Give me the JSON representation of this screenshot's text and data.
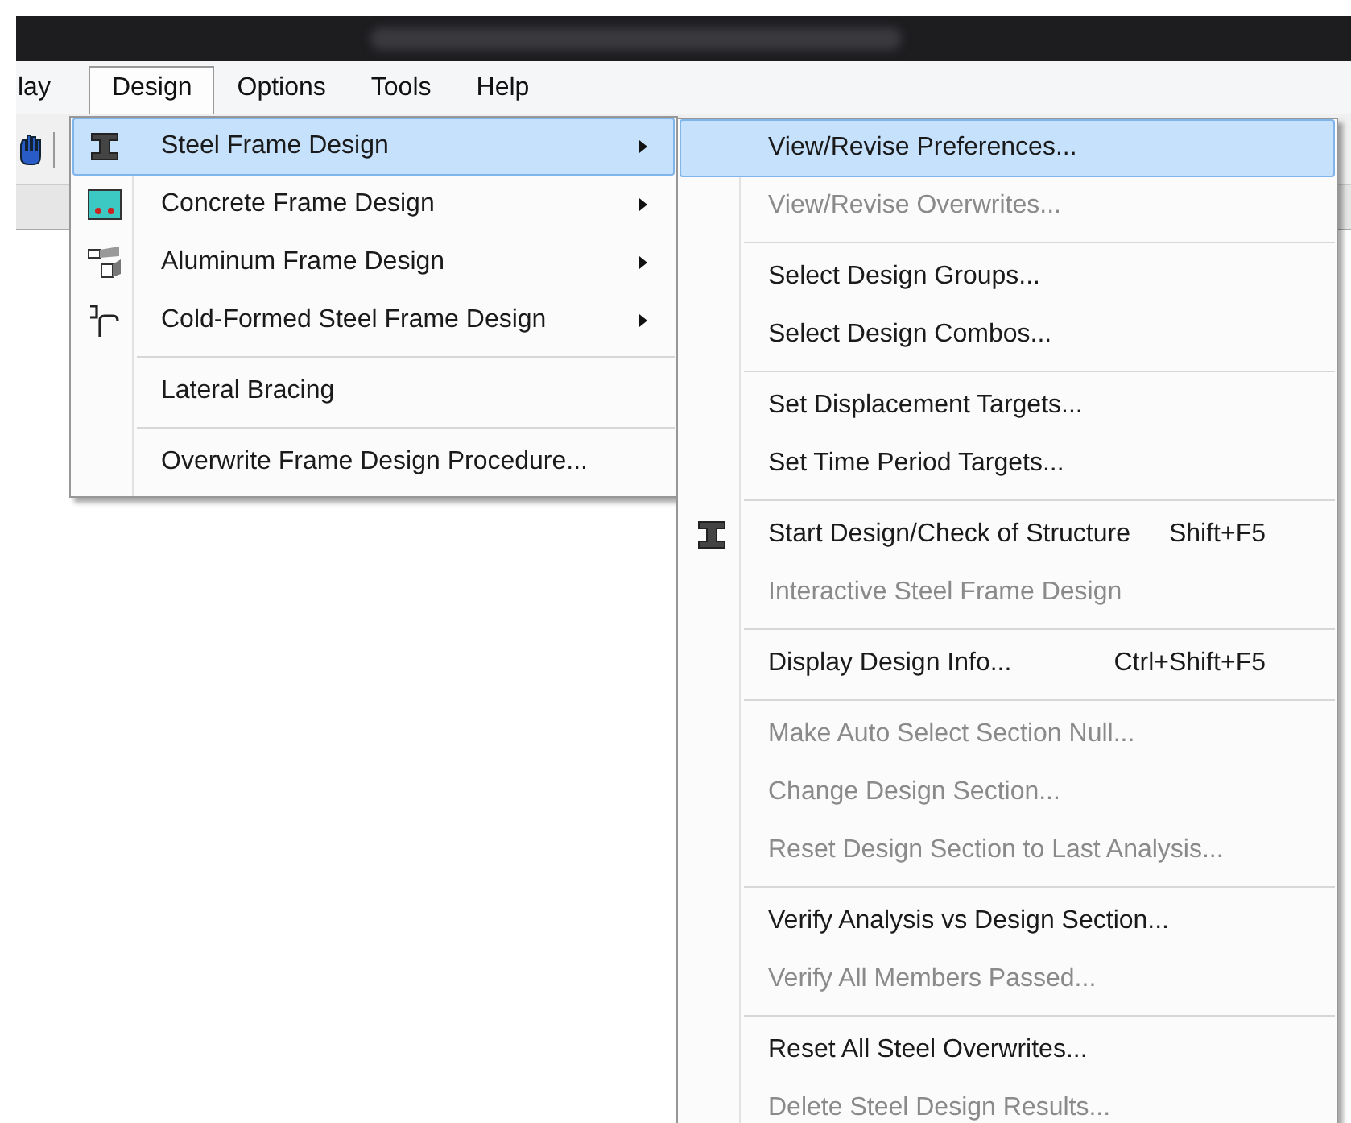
{
  "menubar": {
    "items": [
      {
        "label": "lay",
        "selected": false
      },
      {
        "label": "Design",
        "selected": true
      },
      {
        "label": "Options",
        "selected": false
      },
      {
        "label": "Tools",
        "selected": false
      },
      {
        "label": "Help",
        "selected": false
      }
    ]
  },
  "design_menu": {
    "groups": [
      [
        {
          "label": "Steel Frame Design",
          "submenu": true,
          "selected": true
        },
        {
          "label": "Concrete Frame Design",
          "submenu": true,
          "selected": false
        },
        {
          "label": "Aluminum Frame Design",
          "submenu": true,
          "selected": false
        },
        {
          "label": "Cold-Formed Steel Frame Design",
          "submenu": true,
          "selected": false
        }
      ],
      [
        {
          "label": "Lateral Bracing",
          "submenu": false,
          "selected": false
        }
      ],
      [
        {
          "label": "Overwrite Frame Design Procedure...",
          "submenu": false,
          "selected": false
        }
      ]
    ]
  },
  "steel_submenu": {
    "groups": [
      [
        {
          "label": "View/Revise Preferences...",
          "disabled": false,
          "selected": true
        },
        {
          "label": "View/Revise Overwrites...",
          "disabled": true,
          "selected": false
        }
      ],
      [
        {
          "label": "Select Design Groups...",
          "disabled": false,
          "selected": false
        },
        {
          "label": "Select Design Combos...",
          "disabled": false,
          "selected": false
        }
      ],
      [
        {
          "label": "Set Displacement Targets...",
          "disabled": false,
          "selected": false
        },
        {
          "label": "Set Time Period Targets...",
          "disabled": false,
          "selected": false
        }
      ],
      [
        {
          "label": "Start Design/Check of Structure",
          "shortcut": "Shift+F5",
          "disabled": false,
          "selected": false
        },
        {
          "label": "Interactive Steel Frame Design",
          "disabled": true,
          "selected": false
        }
      ],
      [
        {
          "label": "Display Design Info...",
          "shortcut": "Ctrl+Shift+F5",
          "disabled": false,
          "selected": false
        }
      ],
      [
        {
          "label": "Make Auto Select Section Null...",
          "disabled": true,
          "selected": false
        },
        {
          "label": "Change Design Section...",
          "disabled": true,
          "selected": false
        },
        {
          "label": "Reset Design Section to Last Analysis...",
          "disabled": true,
          "selected": false
        }
      ],
      [
        {
          "label": "Verify Analysis vs Design Section...",
          "disabled": false,
          "selected": false
        },
        {
          "label": "Verify All Members Passed...",
          "disabled": true,
          "selected": false
        }
      ],
      [
        {
          "label": "Reset All Steel Overwrites...",
          "disabled": false,
          "selected": false
        },
        {
          "label": "Delete Steel Design Results...",
          "disabled": true,
          "selected": false
        }
      ]
    ]
  }
}
